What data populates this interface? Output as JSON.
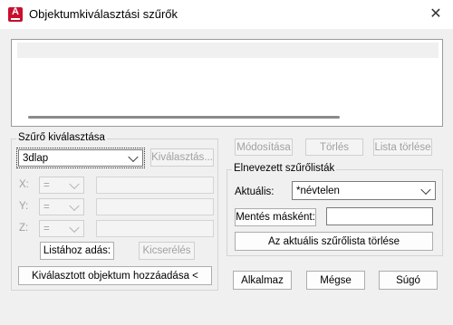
{
  "window": {
    "title": "Objektumkiválasztási szűrők",
    "close_glyph": "✕",
    "app_icon_letter": "A"
  },
  "filter_select": {
    "group_label": "Szűrő kiválasztása",
    "object_type_value": "3dlap",
    "select_button": "Kiválasztás...",
    "x_label": "X:",
    "y_label": "Y:",
    "z_label": "Z:",
    "x_operator": "=",
    "y_operator": "=",
    "z_operator": "=",
    "add_to_list_button": "Listához adás:",
    "replace_button": "Kicserélés",
    "add_selected_object_button": "Kiválasztott objektum hozzáadása <"
  },
  "top_buttons": {
    "edit": "Módosítása",
    "delete": "Törlés",
    "clear_list": "Lista törlése"
  },
  "named_filters": {
    "group_label": "Elnevezett szűrőlisták",
    "current_label": "Aktuális:",
    "current_value": "*névtelen",
    "save_as_button": "Mentés másként:",
    "save_as_value": "",
    "delete_current_button": "Az aktuális szűrőlista törlése"
  },
  "footer": {
    "apply": "Alkalmaz",
    "cancel": "Mégse",
    "help": "Súgó"
  },
  "icons": {
    "app": "autocad-app-icon",
    "close": "close-icon",
    "dropdown": "chevron-down-icon"
  },
  "colors": {
    "app_icon": "#c8102e",
    "dialog_bg": "#f0f0f0",
    "disabled_text": "#a0a0a0"
  }
}
